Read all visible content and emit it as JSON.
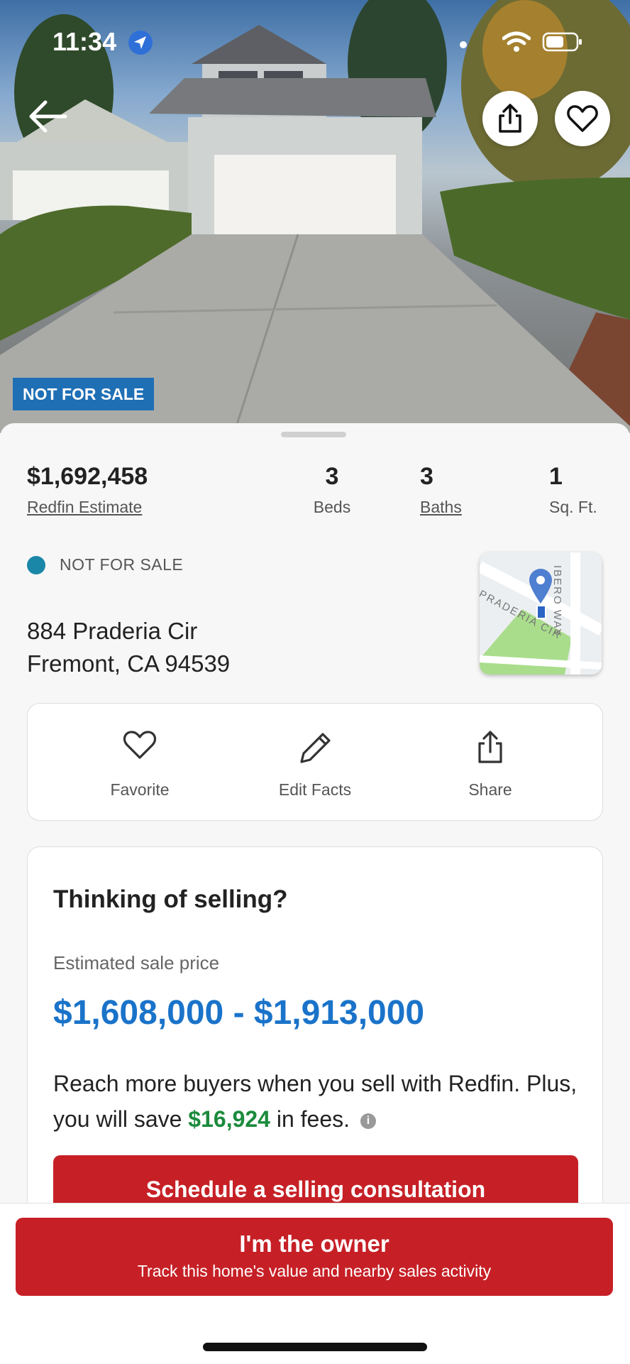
{
  "status_bar": {
    "time": "11:34"
  },
  "hero": {
    "badge": "NOT FOR SALE",
    "back_icon": "arrow-left-icon",
    "share_icon": "share-icon",
    "favorite_icon": "heart-icon"
  },
  "summary": {
    "price": "$1,692,458",
    "price_label": "Redfin Estimate",
    "beds_value": "3",
    "beds_label": "Beds",
    "baths_value": "3",
    "baths_label": "Baths",
    "sqft_value": "1",
    "sqft_label": "Sq. Ft."
  },
  "listing_status": "NOT FOR SALE",
  "address": {
    "line1": "884 Praderia Cir",
    "line2": "Fremont, CA 94539"
  },
  "map": {
    "street1": "PRADERIA CIR",
    "street2": "IBERO WAY"
  },
  "actions": [
    {
      "label": "Favorite",
      "icon": "heart-icon"
    },
    {
      "label": "Edit Facts",
      "icon": "pencil-icon"
    },
    {
      "label": "Share",
      "icon": "share-icon"
    }
  ],
  "selling_card": {
    "title": "Thinking of selling?",
    "subtitle": "Estimated sale price",
    "range": "$1,608,000 - $1,913,000",
    "desc_part1": "Reach more buyers when you sell with Redfin. Plus, you will save",
    "savings": "$16,924",
    "desc_part2": "in fees.",
    "button_label": "Schedule a selling consultation"
  },
  "owner_button": {
    "title": "I'm the owner",
    "subtitle": "Track this home's value and nearby sales activity"
  },
  "colors": {
    "brand_red": "#c62026",
    "estimate_blue": "#1a73c9",
    "savings_green": "#1b8b3c",
    "badge_blue": "#1f6fb5",
    "status_dot": "#1a87a8"
  }
}
